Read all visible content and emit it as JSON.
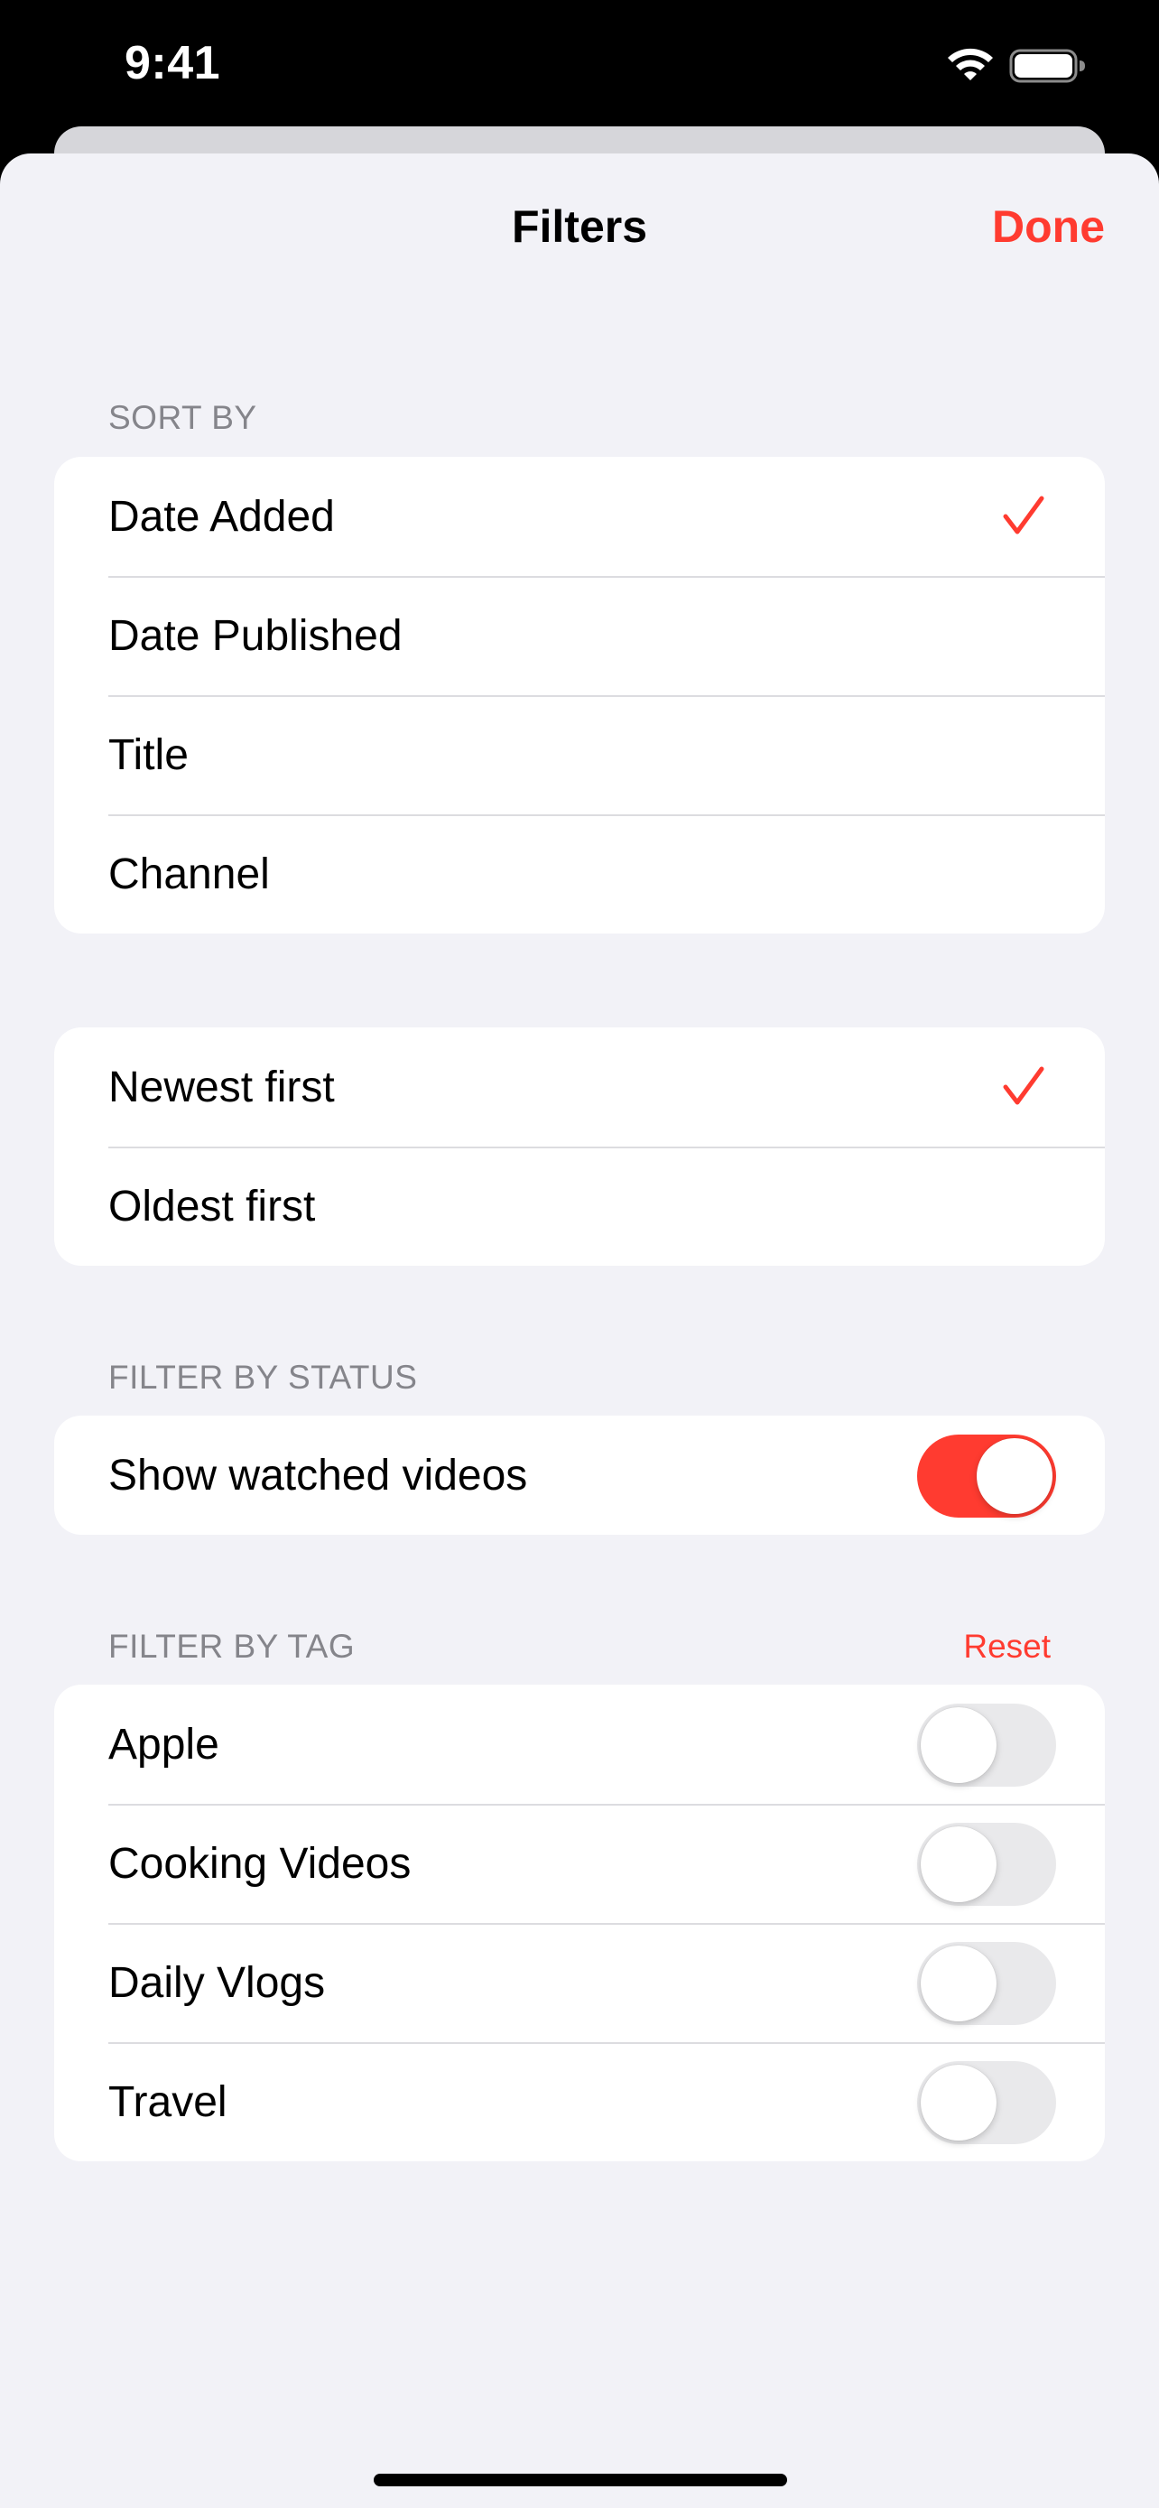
{
  "status_bar": {
    "time": "9:41",
    "wifi_icon": "wifi-icon",
    "battery_icon": "battery-icon"
  },
  "nav": {
    "title": "Filters",
    "done_label": "Done"
  },
  "sort_by": {
    "header": "SORT BY",
    "options": [
      {
        "label": "Date Added",
        "selected": true
      },
      {
        "label": "Date Published",
        "selected": false
      },
      {
        "label": "Title",
        "selected": false
      },
      {
        "label": "Channel",
        "selected": false
      }
    ]
  },
  "order": {
    "options": [
      {
        "label": "Newest first",
        "selected": true
      },
      {
        "label": "Oldest first",
        "selected": false
      }
    ]
  },
  "filter_status": {
    "header": "FILTER BY STATUS",
    "show_watched_label": "Show watched videos",
    "show_watched_on": true
  },
  "filter_tag": {
    "header": "FILTER BY TAG",
    "reset_label": "Reset",
    "tags": [
      {
        "label": "Apple",
        "on": false
      },
      {
        "label": "Cooking Videos",
        "on": false
      },
      {
        "label": "Daily Vlogs",
        "on": false
      },
      {
        "label": "Travel",
        "on": false
      }
    ]
  },
  "colors": {
    "accent": "#ff3b30",
    "background": "#f2f2f7",
    "secondary_text": "#85858b",
    "toggle_off": "#e9e9eb"
  }
}
